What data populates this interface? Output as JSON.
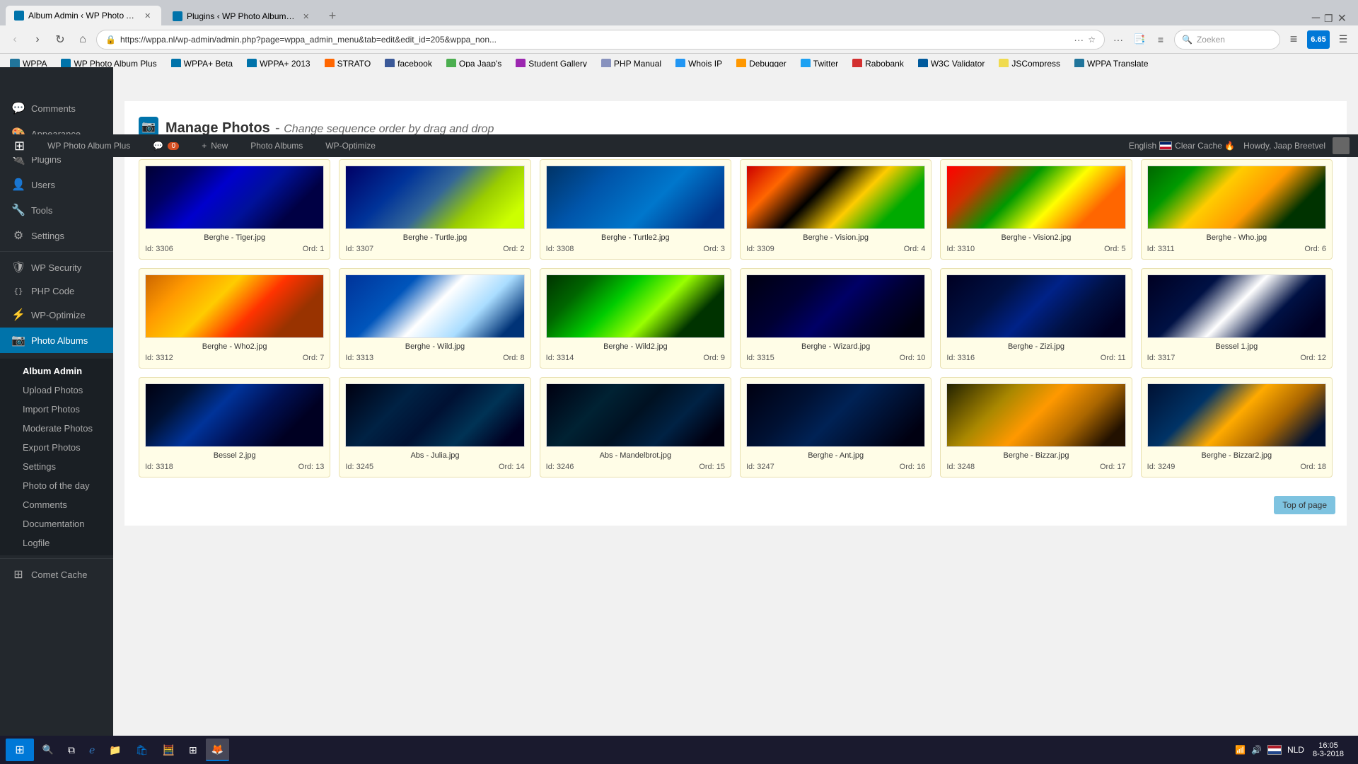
{
  "browser": {
    "tabs": [
      {
        "id": "tab1",
        "favicon_color": "#4285f4",
        "label": "Album Admin ‹ WP Photo Albu...",
        "active": true
      },
      {
        "id": "tab2",
        "favicon_color": "#4285f4",
        "label": "Plugins ‹ WP Photo Album Plu...",
        "active": false
      }
    ],
    "address": "https://wppa.nl/wp-admin/admin.php?page=wppa_admin_menu&tab=edit&edit_id=205&wppa_non...",
    "search_placeholder": "Zoeken",
    "bookmarks": [
      {
        "id": "bm-wp",
        "label": "WPPA",
        "icon_class": "bm-wp"
      },
      {
        "id": "bm-wppa",
        "label": "WP Photo Album Plus",
        "icon_class": "bm-wppa"
      },
      {
        "id": "bm-beta",
        "label": "WPPA+ Beta",
        "icon_class": "bm-beta"
      },
      {
        "id": "bm-2013",
        "label": "WPPA+ 2013",
        "icon_class": "bm-2013"
      },
      {
        "id": "bm-strato",
        "label": "STRATO",
        "icon_class": "bm-strato"
      },
      {
        "id": "bm-fb",
        "label": "facebook",
        "icon_class": "bm-fb"
      },
      {
        "id": "bm-opajaap",
        "label": "Opa Jaap's",
        "icon_class": "bm-opajaap"
      },
      {
        "id": "bm-student",
        "label": "Student Gallery",
        "icon_class": "bm-student"
      },
      {
        "id": "bm-php",
        "label": "PHP Manual",
        "icon_class": "bm-php"
      },
      {
        "id": "bm-whois",
        "label": "Whois IP",
        "icon_class": "bm-whois"
      },
      {
        "id": "bm-debugger",
        "label": "Debugger",
        "icon_class": "bm-debugger"
      },
      {
        "id": "bm-twitter",
        "label": "Twitter",
        "icon_class": "bm-twitter"
      },
      {
        "id": "bm-rabo",
        "label": "Rabobank",
        "icon_class": "bm-rabo"
      },
      {
        "id": "bm-w3c",
        "label": "W3C Validator",
        "icon_class": "bm-w3c"
      },
      {
        "id": "bm-js",
        "label": "JSCompress",
        "icon_class": "bm-js"
      },
      {
        "id": "bm-translate",
        "label": "WPPA Translate",
        "icon_class": "bm-translate"
      }
    ]
  },
  "admin_bar": {
    "logo": "⊞",
    "site_name": "WP Photo Album Plus",
    "comments_count": "0",
    "new_label": "New",
    "photo_albums_label": "Photo Albums",
    "wp_optimize_label": "WP-Optimize",
    "language": "English",
    "clear_cache": "Clear Cache 🔥",
    "howdy": "Howdy, Jaap Breetvel"
  },
  "sidebar": {
    "items": [
      {
        "id": "comments",
        "icon": "💬",
        "label": "Comments"
      },
      {
        "id": "appearance",
        "icon": "🎨",
        "label": "Appearance"
      },
      {
        "id": "plugins",
        "icon": "🔌",
        "label": "Plugins"
      },
      {
        "id": "users",
        "icon": "👤",
        "label": "Users"
      },
      {
        "id": "tools",
        "icon": "🔧",
        "label": "Tools"
      },
      {
        "id": "settings",
        "icon": "⚙",
        "label": "Settings"
      },
      {
        "id": "wp-security",
        "icon": "🛡",
        "label": "WP Security"
      },
      {
        "id": "php-code",
        "icon": "{ }",
        "label": "PHP Code"
      },
      {
        "id": "wp-optimize",
        "icon": "⚡",
        "label": "WP-Optimize"
      },
      {
        "id": "photo-albums",
        "icon": "📷",
        "label": "Photo Albums"
      }
    ],
    "sub_items": [
      {
        "id": "album-admin",
        "label": "Album Admin",
        "active": true
      },
      {
        "id": "upload-photos",
        "label": "Upload Photos"
      },
      {
        "id": "import-photos",
        "label": "Import Photos"
      },
      {
        "id": "moderate-photos",
        "label": "Moderate Photos"
      },
      {
        "id": "export-photos",
        "label": "Export Photos"
      },
      {
        "id": "settings",
        "label": "Settings"
      },
      {
        "id": "photo-of-the-day",
        "label": "Photo of the day"
      },
      {
        "id": "comments",
        "label": "Comments"
      },
      {
        "id": "documentation",
        "label": "Documentation"
      },
      {
        "id": "logfile",
        "label": "Logfile"
      }
    ],
    "comet_cache": "Comet Cache"
  },
  "page": {
    "title": "Manage Photos",
    "subtitle": "Change sequence order by drag and drop",
    "top_of_page_btn": "Top of page"
  },
  "photos": [
    {
      "name": "Berghe - Tiger.jpg",
      "id": "3306",
      "ord": "1",
      "fractal_class": "fractal-tiger"
    },
    {
      "name": "Berghe - Turtle.jpg",
      "id": "3307",
      "ord": "2",
      "fractal_class": "fractal-turtle"
    },
    {
      "name": "Berghe - Turtle2.jpg",
      "id": "3308",
      "ord": "3",
      "fractal_class": "fractal-turtle2"
    },
    {
      "name": "Berghe - Vision.jpg",
      "id": "3309",
      "ord": "4",
      "fractal_class": "fractal-vision"
    },
    {
      "name": "Berghe - Vision2.jpg",
      "id": "3310",
      "ord": "5",
      "fractal_class": "fractal-vision2"
    },
    {
      "name": "Berghe - Who.jpg",
      "id": "3311",
      "ord": "6",
      "fractal_class": "fractal-who"
    },
    {
      "name": "Berghe - Who2.jpg",
      "id": "3312",
      "ord": "7",
      "fractal_class": "fractal-who2"
    },
    {
      "name": "Berghe - Wild.jpg",
      "id": "3313",
      "ord": "8",
      "fractal_class": "fractal-wild"
    },
    {
      "name": "Berghe - Wild2.jpg",
      "id": "3314",
      "ord": "9",
      "fractal_class": "fractal-wild2"
    },
    {
      "name": "Berghe - Wizard.jpg",
      "id": "3315",
      "ord": "10",
      "fractal_class": "fractal-wizard"
    },
    {
      "name": "Berghe - Zizi.jpg",
      "id": "3316",
      "ord": "11",
      "fractal_class": "fractal-zizi"
    },
    {
      "name": "Bessel 1.jpg",
      "id": "3317",
      "ord": "12",
      "fractal_class": "fractal-bessel1"
    },
    {
      "name": "Bessel 2.jpg",
      "id": "3318",
      "ord": "13",
      "fractal_class": "fractal-bessel2"
    },
    {
      "name": "Abs - Julia.jpg",
      "id": "3245",
      "ord": "14",
      "fractal_class": "fractal-julia"
    },
    {
      "name": "Abs - Mandelbrot.jpg",
      "id": "3246",
      "ord": "15",
      "fractal_class": "fractal-mandel"
    },
    {
      "name": "Berghe - Ant.jpg",
      "id": "3247",
      "ord": "16",
      "fractal_class": "fractal-ant"
    },
    {
      "name": "Berghe - Bizzar.jpg",
      "id": "3248",
      "ord": "17",
      "fractal_class": "fractal-bizzar"
    },
    {
      "name": "Berghe - Bizzar2.jpg",
      "id": "3249",
      "ord": "18",
      "fractal_class": "fractal-bizzar2"
    }
  ],
  "id_label": "Id:",
  "ord_label": "Ord:",
  "taskbar": {
    "time": "16:05",
    "date": "8-3-2018",
    "language": "NLD"
  }
}
